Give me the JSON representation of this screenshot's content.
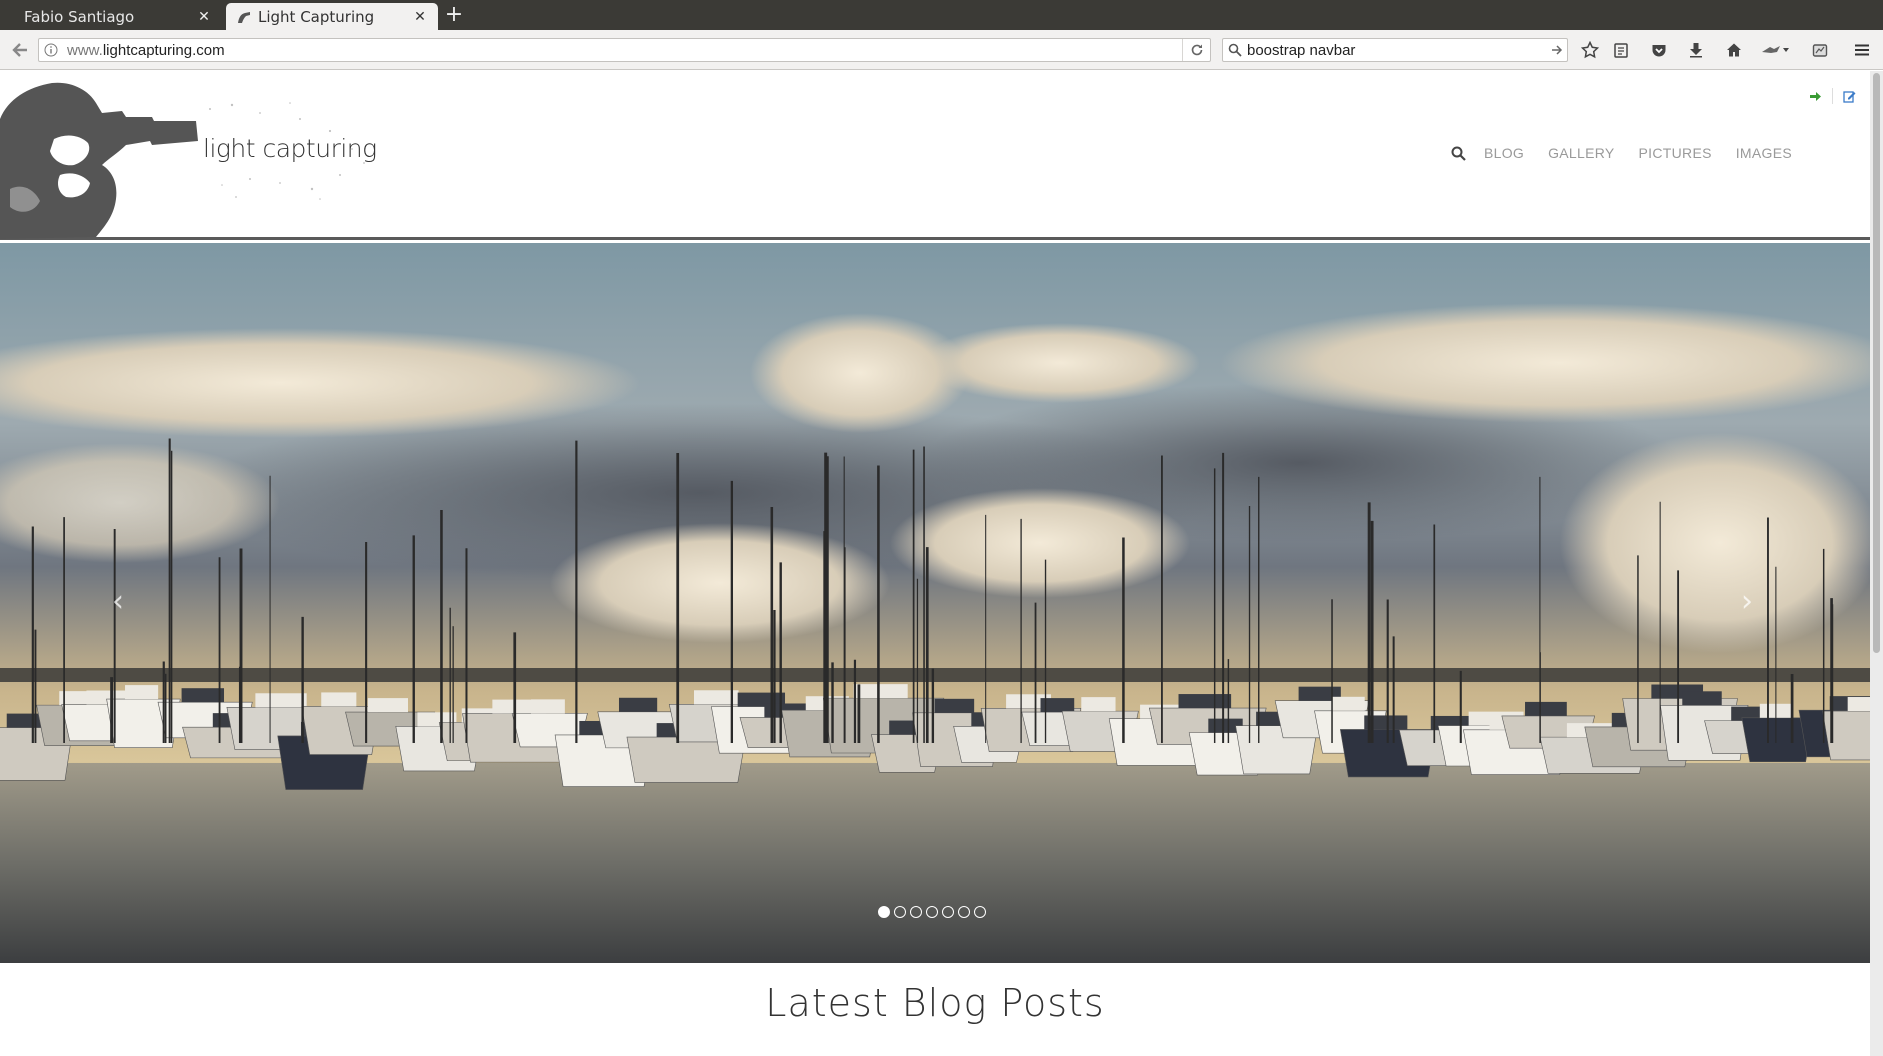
{
  "browser": {
    "tabs": [
      {
        "label": "Fabio Santiago",
        "active": false
      },
      {
        "label": "Light Capturing",
        "active": true
      }
    ],
    "url_prefix": "www.",
    "url_domain": "lightcapturing.com",
    "search_value": "boostrap navbar"
  },
  "site": {
    "logo_text": "light capturing",
    "nav": [
      "BLOG",
      "GALLERY",
      "PICTURES",
      "IMAGES"
    ],
    "carousel": {
      "slide_count": 7,
      "active_index": 0,
      "prev_glyph": "‹",
      "next_glyph": "›"
    },
    "section_title": "Latest Blog Posts"
  },
  "colors": {
    "login_icon": "#3a9b34",
    "edit_icon": "#3a7bc8",
    "nav_text": "#9a9a9a",
    "header_rule": "#5a5a5a"
  }
}
